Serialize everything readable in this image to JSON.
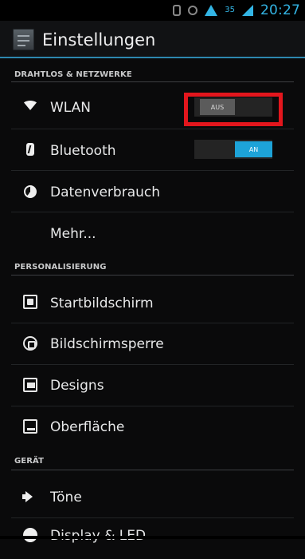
{
  "status_bar": {
    "time": "20:27",
    "battery": "35"
  },
  "header": {
    "title": "Einstellungen"
  },
  "sections": {
    "wireless": "DRAHTLOS & NETZWERKE",
    "personalization": "PERSONALISIERUNG",
    "device": "GERÄT"
  },
  "items": {
    "wlan": "WLAN",
    "bluetooth": "Bluetooth",
    "data_usage": "Datenverbrauch",
    "more": "Mehr...",
    "home_screen": "Startbildschirm",
    "lock_screen": "Bildschirmsperre",
    "designs": "Designs",
    "interface": "Oberfläche",
    "sounds": "Töne",
    "display_led": "Display & LED"
  },
  "toggles": {
    "wlan": "AUS",
    "bluetooth": "AN"
  }
}
